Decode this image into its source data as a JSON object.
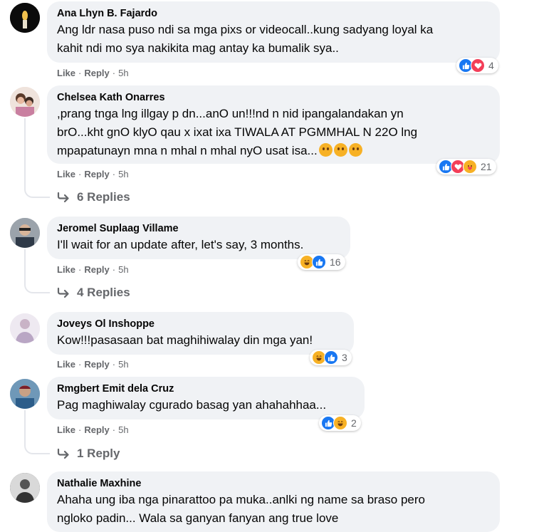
{
  "colors": {
    "bubble": "#f0f2f5",
    "meta": "#65676b",
    "like": "#1877f2",
    "love": "#f33e58",
    "haha": "#f7b125"
  },
  "labels": {
    "like": "Like",
    "reply": "Reply",
    "separator": "·"
  },
  "comments": [
    {
      "author": "Ana Lhyn B. Fajardo",
      "lines": [
        "Ang ldr nasa puso ndi sa mga pixs or videocall..kung sadyang loyal ka",
        "kahit ndi mo sya nakikita mag antay ka bumalik sya.."
      ],
      "time": "5h",
      "reactions": [
        "like-icon",
        "love-icon"
      ],
      "reaction_count": "4"
    },
    {
      "author": "Chelsea Kath Onarres",
      "lines": [
        ",prang tnga lng illgay p dn...anO un!!!nd n nid ipangalandakan yn",
        "brO...kht gnO klyO qau x ixat ixa TIWALA AT PGMMHAL N 22O lng",
        "mpapatunayn mna n mhal n mhal nyO usat isa..."
      ],
      "emojis": [
        "smiling-face-emoji",
        "smiling-face-emoji",
        "smiling-face-emoji"
      ],
      "time": "5h",
      "reactions": [
        "like-icon",
        "love-icon",
        "care-icon"
      ],
      "reaction_count": "21",
      "replies": "6 Replies"
    },
    {
      "author": "Jeromel Suplaag Villame",
      "lines": [
        "I'll wait for an update after, let's say, 3 months."
      ],
      "time": "5h",
      "reactions": [
        "haha-icon",
        "like-icon"
      ],
      "reaction_count": "16",
      "replies": "4 Replies"
    },
    {
      "author": "Joveys Ol Inshoppe",
      "lines": [
        "Kow!!!pasasaan bat maghihiwalay din mga yan!"
      ],
      "time": "5h",
      "reactions": [
        "haha-icon",
        "like-icon"
      ],
      "reaction_count": "3"
    },
    {
      "author": "Rmgbert Emit dela Cruz",
      "lines": [
        "Pag maghiwalay cgurado basag yan ahahahhaa..."
      ],
      "time": "5h",
      "reactions": [
        "like-icon",
        "haha-icon"
      ],
      "reaction_count": "2",
      "replies": "1 Reply"
    },
    {
      "author": "Nathalie Maxhine",
      "lines": [
        "Ahaha ung iba nga pinarattoo pa muka..anlki ng name sa braso pero",
        "ngloko padin... Wala sa ganyan fanyan ang true love"
      ]
    }
  ]
}
